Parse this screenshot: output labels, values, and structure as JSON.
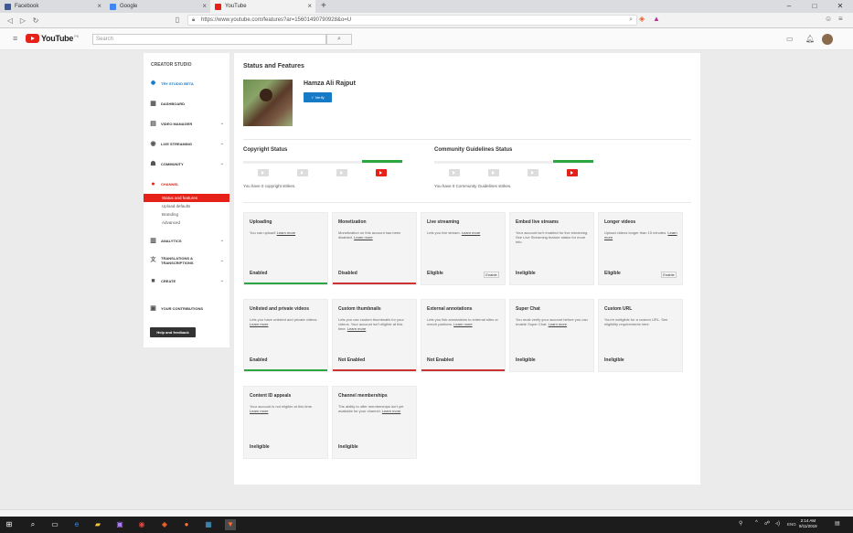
{
  "browser": {
    "tabs": [
      {
        "label": "Facebook",
        "color": "#3b5998"
      },
      {
        "label": "Google",
        "color": "#4285f4"
      },
      {
        "label": "YouTube",
        "color": "#e62117"
      }
    ],
    "new_tab": "+",
    "window_controls": [
      "–",
      "□",
      "✕"
    ],
    "back": "◁",
    "forward": "▷",
    "reload": "↻",
    "url": "https://www.youtube.com/features?ar=15601490790928&o=U",
    "bookmark_icon": "▯"
  },
  "youtube": {
    "logo_text": "YouTube",
    "country": "PK",
    "search_placeholder": "Search",
    "search_icon": "⌕"
  },
  "sidebar": {
    "header": "CREATOR STUDIO",
    "items": [
      {
        "label": "TRY STUDIO BETA",
        "icon": "gear-icon",
        "glyph": "✹",
        "style": "blue",
        "chevron": ""
      },
      {
        "label": "DASHBOARD",
        "icon": "dashboard-icon",
        "glyph": "▦",
        "style": "",
        "chevron": ""
      },
      {
        "label": "VIDEO MANAGER",
        "icon": "video-manager-icon",
        "glyph": "▤",
        "style": "",
        "chevron": "⌄"
      },
      {
        "label": "LIVE STREAMING",
        "icon": "live-streaming-icon",
        "glyph": "◉",
        "style": "",
        "chevron": "⌄"
      },
      {
        "label": "COMMUNITY",
        "icon": "community-icon",
        "glyph": "☗",
        "style": "",
        "chevron": "⌄"
      },
      {
        "label": "CHANNEL",
        "icon": "channel-icon",
        "glyph": "●",
        "style": "red",
        "chevron": ""
      }
    ],
    "channel_subitems": [
      "Status and features",
      "Upload defaults",
      "Branding",
      "Advanced"
    ],
    "items2": [
      {
        "label": "ANALYTICS",
        "icon": "analytics-icon",
        "glyph": "▥",
        "chevron": "⌄"
      },
      {
        "label": "TRANSLATIONS & TRANSCRIPTIONS",
        "icon": "translations-icon",
        "glyph": "文",
        "chevron": "⌄"
      },
      {
        "label": "CREATE",
        "icon": "create-icon",
        "glyph": "■",
        "chevron": "⌄"
      },
      {
        "label": "YOUR CONTRIBUTIONS",
        "icon": "contributions-icon",
        "glyph": "▣",
        "chevron": ""
      }
    ],
    "help_button": "Help and feedback"
  },
  "main": {
    "title": "Status and Features",
    "profile_name": "Hamza Ali Rajput",
    "verify_label": "✓ Verify",
    "copyright": {
      "title": "Copyright Status",
      "text": "You have 0 copyright strikes."
    },
    "community": {
      "title": "Community Guidelines Status",
      "text": "You have 0 Community Guidelines strikes."
    },
    "cards": [
      {
        "title": "Uploading",
        "desc": "You can upload!",
        "link": "Learn more",
        "status": "Enabled",
        "button": "",
        "bar": "#2ba640"
      },
      {
        "title": "Monetization",
        "desc": "Monetization on this account has been disabled.",
        "link": "Learn more",
        "status": "Disabled",
        "button": "",
        "bar": "#cc3333"
      },
      {
        "title": "Live streaming",
        "desc": "Lets you live stream.",
        "link": "Learn more",
        "status": "Eligible",
        "button": "Enable",
        "bar": ""
      },
      {
        "title": "Embed live streams",
        "desc": "Your account isn't enabled for live streaming. See Live Streaming feature status for more info.",
        "link": "",
        "status": "Ineligible",
        "button": "",
        "bar": ""
      },
      {
        "title": "Longer videos",
        "desc": "Upload videos longer than 15 minutes.",
        "link": "Learn more",
        "status": "Eligible",
        "button": "Enable",
        "bar": ""
      },
      {
        "title": "Unlisted and private videos",
        "desc": "Lets you have unlisted and private videos.",
        "link": "Learn more",
        "status": "Enabled",
        "button": "",
        "bar": "#2ba640"
      },
      {
        "title": "Custom thumbnails",
        "desc": "Lets you use custom thumbnails for your videos. Your account isn't eligible at this time.",
        "link": "Learn more",
        "status": "Not Enabled",
        "button": "",
        "bar": "#cc3333"
      },
      {
        "title": "External annotations",
        "desc": "Lets you link annotations to external sites or merch partners.",
        "link": "Learn more",
        "status": "Not Enabled",
        "button": "",
        "bar": "#cc3333"
      },
      {
        "title": "Super Chat",
        "desc": "You must verify your account before you can enable Super Chat.",
        "link": "Learn more",
        "status": "Ineligible",
        "button": "",
        "bar": ""
      },
      {
        "title": "Custom URL",
        "desc": "You're ineligible for a custom URL. See eligibility requirements here",
        "link": "",
        "status": "Ineligible",
        "button": "",
        "bar": ""
      },
      {
        "title": "Content ID appeals",
        "desc": "Your account is not eligible at this time.",
        "link": "Learn more",
        "status": "Ineligible",
        "button": "",
        "bar": ""
      },
      {
        "title": "Channel memberships",
        "desc": "The ability to offer memberships isn't yet available for your channel.",
        "link": "Learn more",
        "status": "Ineligible",
        "button": "",
        "bar": ""
      }
    ]
  },
  "taskbar": {
    "time": "2:14 AM",
    "date": "9/11/2019",
    "lang": "ENG"
  }
}
